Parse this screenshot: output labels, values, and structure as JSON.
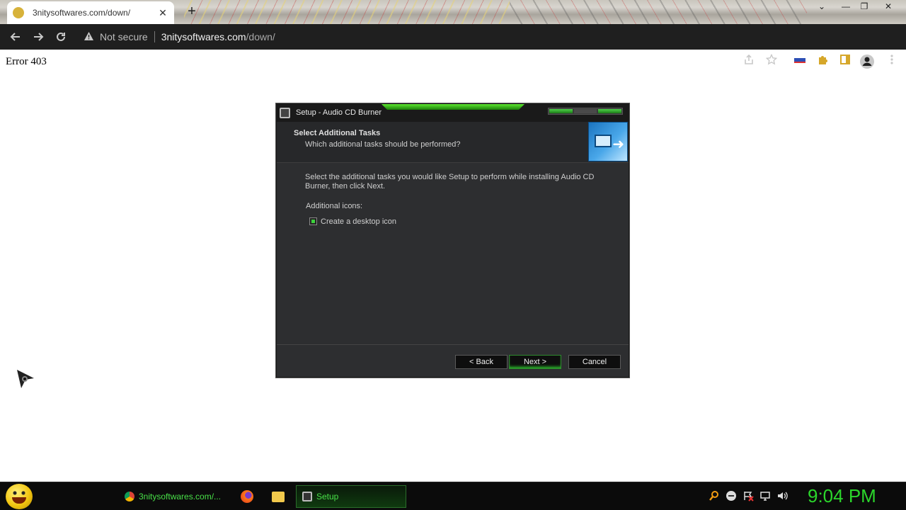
{
  "browser": {
    "tab_title": "3nitysoftwares.com/down/",
    "tab_close": "✕",
    "new_tab": "+",
    "security_label": "Not secure",
    "url_host": "3nitysoftwares.com",
    "url_path": "/down/",
    "window_controls": [
      "⌄",
      "—",
      "❐",
      "✕"
    ]
  },
  "page": {
    "error_text": "Error 403"
  },
  "dialog": {
    "title": "Setup - Audio CD Burner",
    "header_title": "Select Additional Tasks",
    "header_subtitle": "Which additional tasks should be performed?",
    "intro_text": "Select the additional tasks you would like Setup to perform while installing Audio CD Burner, then click Next.",
    "group_label": "Additional icons:",
    "checkbox_label": "Create a desktop icon",
    "checkbox_checked": true,
    "buttons": {
      "back": "< Back",
      "next": "Next >",
      "cancel": "Cancel"
    }
  },
  "taskbar": {
    "tasks": [
      {
        "label": "3nitysoftwares.com/...",
        "icon": "chrome-icon"
      },
      {
        "label": "",
        "icon": "firefox-icon"
      },
      {
        "label": "",
        "icon": "folder-icon"
      },
      {
        "label": "Setup",
        "icon": "setup-icon"
      }
    ],
    "tray_icons": [
      "search-icon",
      "network-icon",
      "flag-icon",
      "monitor-icon",
      "volume-icon"
    ],
    "clock": "9:04 PM"
  },
  "colors": {
    "accent_green": "#2bd62b",
    "dialog_bg": "#2d2e30",
    "toolbar_bg": "#1f1f1f"
  }
}
